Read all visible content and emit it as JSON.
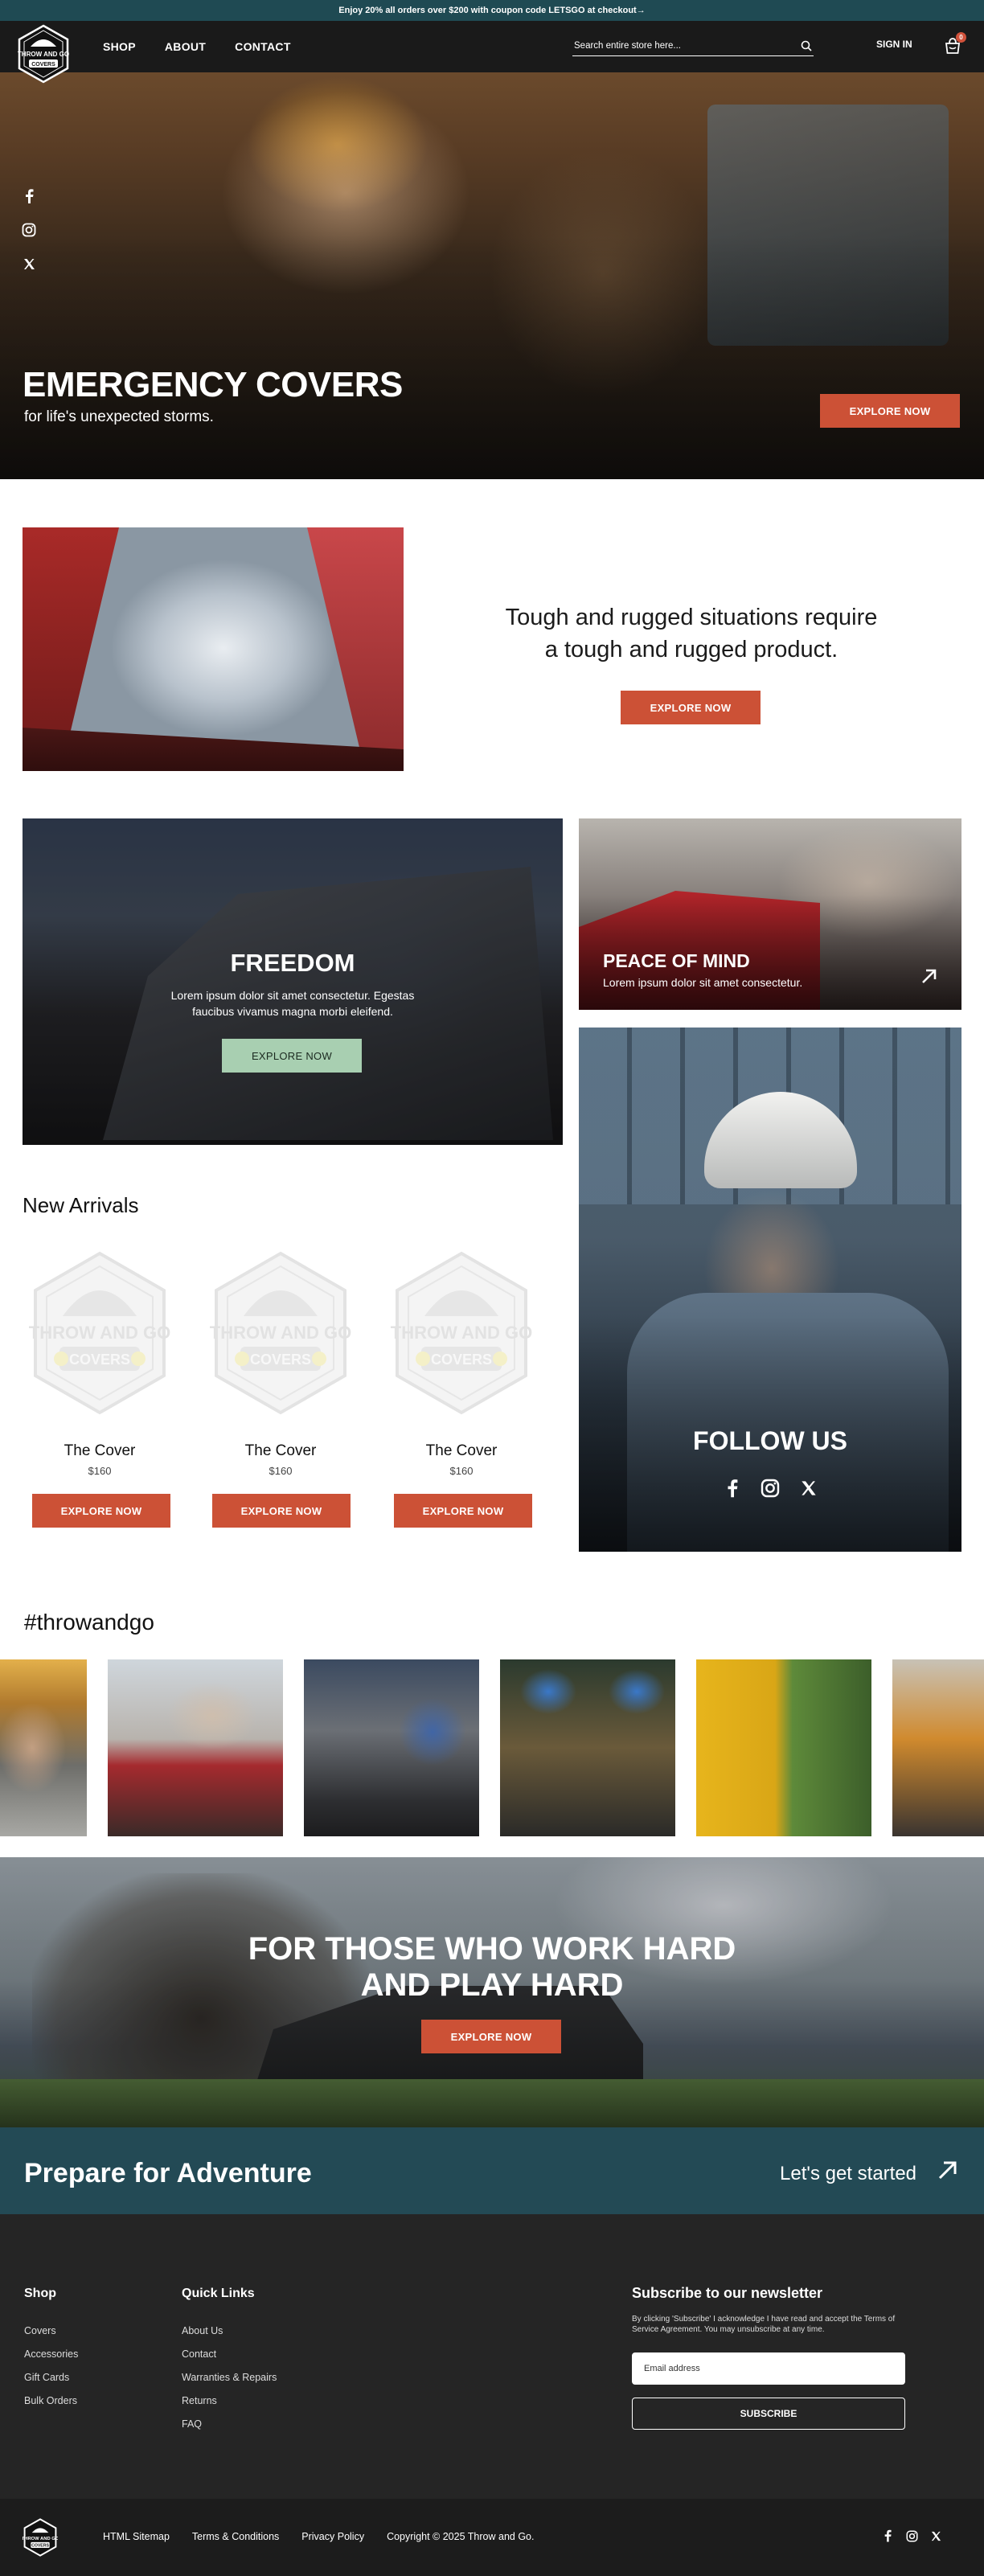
{
  "announcement": "Enjoy 20% all orders over $200 with coupon code LETSGO at checkout→",
  "header": {
    "logo_text": [
      "THROW AND GO",
      "COVERS"
    ],
    "nav": [
      "SHOP",
      "ABOUT",
      "CONTACT"
    ],
    "search_placeholder": "Search entire store here...",
    "sign_in": "SIGN IN",
    "cart_count": "0",
    "icons": [
      "search-icon",
      "cart-icon"
    ]
  },
  "hero": {
    "title": "EMERGENCY COVERS",
    "subtitle": "for life's unexpected storms.",
    "cta": "EXPLORE NOW",
    "social_icons": [
      "facebook-icon",
      "instagram-icon",
      "x-icon"
    ]
  },
  "tough": {
    "heading_line1": "Tough and rugged situations require",
    "heading_line2": "a tough and rugged product.",
    "cta": "EXPLORE NOW"
  },
  "freedom": {
    "title": "FREEDOM",
    "text": "Lorem ipsum dolor sit amet consectetur. Egestas faucibus vivamus magna morbi eleifend.",
    "cta": "EXPLORE NOW"
  },
  "peace": {
    "title": "PEACE OF MIND",
    "text": "Lorem ipsum dolor sit amet consectetur.",
    "icon": "arrow-up-right-icon"
  },
  "follow": {
    "title": "FOLLOW US",
    "icons": [
      "facebook-icon",
      "instagram-icon",
      "x-icon"
    ]
  },
  "new_arrivals": {
    "title": "New Arrivals",
    "products": [
      {
        "name": "The Cover",
        "price": "$160",
        "cta": "EXPLORE NOW"
      },
      {
        "name": "The Cover",
        "price": "$160",
        "cta": "EXPLORE NOW"
      },
      {
        "name": "The Cover",
        "price": "$160",
        "cta": "EXPLORE NOW"
      }
    ]
  },
  "hashtag": {
    "title": "#throwandgo"
  },
  "workhard": {
    "line1": "FOR THOSE WHO WORK HARD",
    "line2": "AND PLAY HARD",
    "cta": "EXPLORE NOW"
  },
  "prepare": {
    "title": "Prepare for Adventure",
    "cta": "Let's get started",
    "icon": "arrow-up-right-icon"
  },
  "footer": {
    "shop_title": "Shop",
    "shop_links": [
      "Covers",
      "Accessories",
      "Gift Cards",
      "Bulk Orders"
    ],
    "quick_title": "Quick Links",
    "quick_links": [
      "About Us",
      "Contact",
      "Warranties & Repairs",
      "Returns",
      "FAQ"
    ],
    "newsletter_title": "Subscribe to our newsletter",
    "newsletter_text": "By clicking 'Subscribe' I acknowledge I have read and accept the Terms of Service Agreement. You may unsubscribe at any time.",
    "email_placeholder": "Email address",
    "subscribe": "SUBSCRIBE"
  },
  "bottom": {
    "links": [
      "HTML Sitemap",
      "Terms & Conditions",
      "Privacy Policy"
    ],
    "copyright": "Copyright © 2025 Throw and Go.",
    "social_icons": [
      "facebook-icon",
      "instagram-icon",
      "x-icon"
    ]
  },
  "colors": {
    "accent": "#cc5136",
    "teal": "#234a55",
    "mint": "#a8cfb1",
    "dark": "#1a1a1a"
  }
}
